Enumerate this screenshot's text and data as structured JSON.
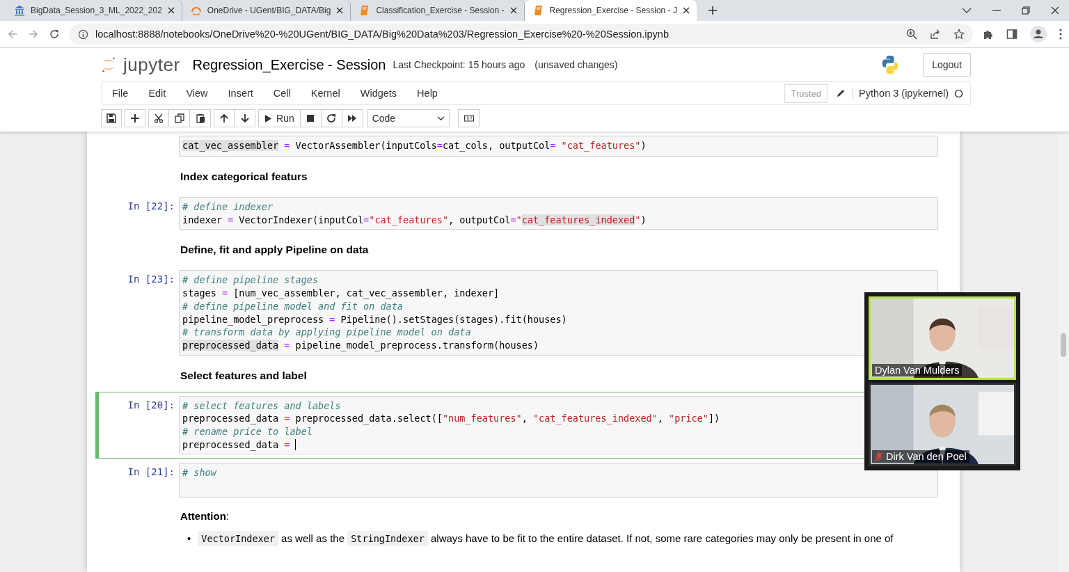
{
  "browser": {
    "tabs": [
      {
        "title": "BigData_Session_3_ML_2022_202",
        "selected": false
      },
      {
        "title": "OneDrive - UGent/BIG_DATA/Big",
        "selected": false
      },
      {
        "title": "Classification_Exercise - Session -",
        "selected": false
      },
      {
        "title": "Regression_Exercise - Session - J",
        "selected": true
      }
    ],
    "url": "localhost:8888/notebooks/OneDrive%20-%20UGent/BIG_DATA/Big%20Data%203/Regression_Exercise%20-%20Session.ipynb"
  },
  "notebook": {
    "logo_text": "jupyter",
    "title": "Regression_Exercise - Session",
    "checkpoint": "Last Checkpoint: 15 hours ago",
    "save_status": "(unsaved changes)",
    "logout": "Logout",
    "menus": [
      "File",
      "Edit",
      "View",
      "Insert",
      "Cell",
      "Kernel",
      "Widgets",
      "Help"
    ],
    "trusted": "Trusted",
    "kernel": "Python 3 (ipykernel)",
    "kernel_busy": false,
    "toolbar": {
      "run_label": "Run",
      "cell_type": "Code"
    }
  },
  "cells": [
    {
      "kind": "code",
      "selected": false,
      "lines": [
        [
          {
            "text": "cat_vec_assembler",
            "kind": "match"
          },
          {
            "text": " =",
            "kind": "operator"
          },
          {
            "text": " VectorAssembler(inputCols",
            "kind": "plain"
          },
          {
            "text": "=",
            "kind": "operator"
          },
          {
            "text": "cat_cols, outputCol",
            "kind": "plain"
          },
          {
            "text": "= ",
            "kind": "operator"
          },
          {
            "text": "\"cat_features\"",
            "kind": "string"
          },
          {
            "text": ")",
            "kind": "plain"
          }
        ]
      ]
    },
    {
      "kind": "markdown",
      "text": "Index categorical featurs"
    },
    {
      "kind": "code",
      "prompt": "In [22]:",
      "selected": false,
      "lines": [
        [
          {
            "text": "# define indexer",
            "kind": "comment"
          }
        ],
        [
          {
            "text": "indexer ",
            "kind": "plain"
          },
          {
            "text": "=",
            "kind": "operator"
          },
          {
            "text": " VectorIndexer(inputCol",
            "kind": "plain"
          },
          {
            "text": "=",
            "kind": "operator"
          },
          {
            "text": "\"cat_features\"",
            "kind": "string"
          },
          {
            "text": ", outputCol",
            "kind": "plain"
          },
          {
            "text": "=",
            "kind": "operator"
          },
          {
            "text": "\"",
            "kind": "string"
          },
          {
            "text": "cat_features_indexed",
            "kind": "string-match"
          },
          {
            "text": "\"",
            "kind": "string"
          },
          {
            "text": ")",
            "kind": "plain"
          }
        ]
      ]
    },
    {
      "kind": "markdown",
      "text": "Define, fit and apply Pipeline on data"
    },
    {
      "kind": "code",
      "prompt": "In [23]:",
      "selected": false,
      "lines": [
        [
          {
            "text": "# define pipeline stages",
            "kind": "comment"
          }
        ],
        [
          {
            "text": "stages ",
            "kind": "plain"
          },
          {
            "text": "=",
            "kind": "operator"
          },
          {
            "text": " [num_vec_assembler, cat_vec_assembler, indexer]",
            "kind": "plain"
          }
        ],
        [
          {
            "text": "# define pipeline model and fit on data",
            "kind": "comment"
          }
        ],
        [
          {
            "text": "pipeline_model_preprocess ",
            "kind": "plain"
          },
          {
            "text": "=",
            "kind": "operator"
          },
          {
            "text": " Pipeline().setStages(stages).fit(houses)",
            "kind": "plain"
          }
        ],
        [
          {
            "text": "# transform data by applying pipeline model on data",
            "kind": "comment"
          }
        ],
        [
          {
            "text": "preprocessed_data",
            "kind": "match"
          },
          {
            "text": " =",
            "kind": "operator"
          },
          {
            "text": " pipeline_model_preprocess.transform(houses)",
            "kind": "plain"
          }
        ]
      ]
    },
    {
      "kind": "markdown",
      "text": "Select features and label"
    },
    {
      "kind": "code",
      "prompt": "In [20]:",
      "selected": true,
      "lines": [
        [
          {
            "text": "# select features and labels",
            "kind": "comment"
          }
        ],
        [
          {
            "text": "preprocessed_data ",
            "kind": "plain"
          },
          {
            "text": "=",
            "kind": "operator"
          },
          {
            "text": " preprocessed_data.select([",
            "kind": "plain"
          },
          {
            "text": "\"num_features\"",
            "kind": "string"
          },
          {
            "text": ", ",
            "kind": "plain"
          },
          {
            "text": "\"cat_features_indexed\"",
            "kind": "string"
          },
          {
            "text": ", ",
            "kind": "plain"
          },
          {
            "text": "\"price\"",
            "kind": "string"
          },
          {
            "text": "])",
            "kind": "plain"
          }
        ],
        [
          {
            "text": "# rename price to label",
            "kind": "comment"
          }
        ],
        [
          {
            "text": "preprocessed_data ",
            "kind": "plain"
          },
          {
            "text": "=",
            "kind": "operator"
          }
        ]
      ]
    },
    {
      "kind": "code",
      "prompt": "In [21]:",
      "selected": false,
      "lines": [
        [
          {
            "text": "# show",
            "kind": "comment"
          }
        ]
      ]
    },
    {
      "kind": "markdown-text",
      "text": "**Attention**:"
    },
    {
      "kind": "bullet",
      "marker": "•",
      "parts": [
        {
          "text": "VectorIndexer",
          "kind": "code"
        },
        {
          "text": " as well as the ",
          "kind": "text"
        },
        {
          "text": "StringIndexer",
          "kind": "code"
        },
        {
          "text": " always have to be fit to the entire dataset. If not, some rare categories may only be present in one of",
          "kind": "text"
        }
      ]
    }
  ],
  "call": {
    "participants": [
      {
        "name": "Dylan Van Mulders",
        "speaking": true,
        "muted": false
      },
      {
        "name": "Dirk Van den Poel",
        "speaking": false,
        "muted": true
      }
    ]
  }
}
